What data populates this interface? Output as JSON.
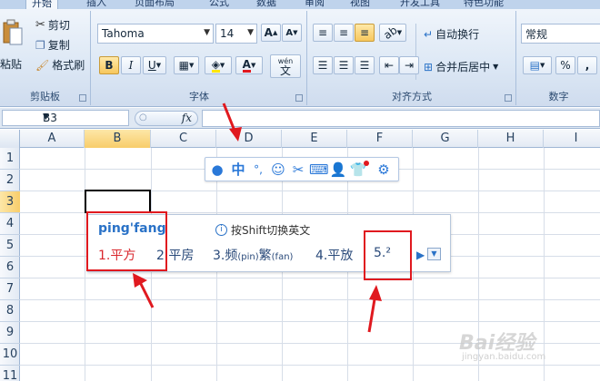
{
  "ribbon": {
    "tabs": [
      "开始",
      "插入",
      "页面布局",
      "公式",
      "数据",
      "审阅",
      "视图",
      "开发工具",
      "特色功能"
    ],
    "clipboard": {
      "paste_label": "粘贴",
      "cut_label": "剪切",
      "copy_label": "复制",
      "format_painter_label": "格式刷",
      "group_title": "剪贴板"
    },
    "font": {
      "font_name": "Tahoma",
      "font_size": "14",
      "grow_label": "A",
      "shrink_label": "A",
      "bold_label": "B",
      "italic_label": "I",
      "underline_label": "U",
      "phonetic_label": "wén",
      "phonetic_char": "文",
      "font_color_label": "A",
      "group_title": "字体",
      "font_color": "#e0191f",
      "highlight_color": "#ffe600"
    },
    "alignment": {
      "wrap_label": "自动换行",
      "merge_label": "合并后居中",
      "group_title": "对齐方式"
    },
    "number": {
      "format_value": "常规",
      "percent_label": "%",
      "comma_label": ",",
      "group_title": "数字"
    }
  },
  "formula_bar": {
    "name_box": "B3",
    "fx_label": "fx",
    "formula": ""
  },
  "grid": {
    "columns": [
      "A",
      "B",
      "C",
      "D",
      "E",
      "F",
      "G",
      "H",
      "I"
    ],
    "rows": [
      "1",
      "2",
      "3",
      "4",
      "5",
      "6",
      "7",
      "8",
      "9",
      "10",
      "11"
    ],
    "active_cell": "B3"
  },
  "ime": {
    "toolbar": {
      "mode_label": "中",
      "punct_label": "°,"
    },
    "pinyin": "ping'fang",
    "hint": "按Shift切换英文",
    "candidates": [
      {
        "index": "1.",
        "text": "平方"
      },
      {
        "index": "2.",
        "text": "平房"
      },
      {
        "index": "3.",
        "text": "频",
        "sub": "(pin)",
        "text2": "繁",
        "sub2": "(fan)"
      },
      {
        "index": "4.",
        "text": "平放"
      },
      {
        "index": "5.",
        "text": "²"
      }
    ],
    "next_label": "▶",
    "dropdown_label": "▼"
  },
  "watermark": {
    "text": "Bai经验",
    "sub": "jingyan.baidu.com"
  },
  "colors": {
    "annotation_red": "#e0191f",
    "ime_blue": "#2a72c7",
    "selected_header": "#f8cd6a"
  }
}
